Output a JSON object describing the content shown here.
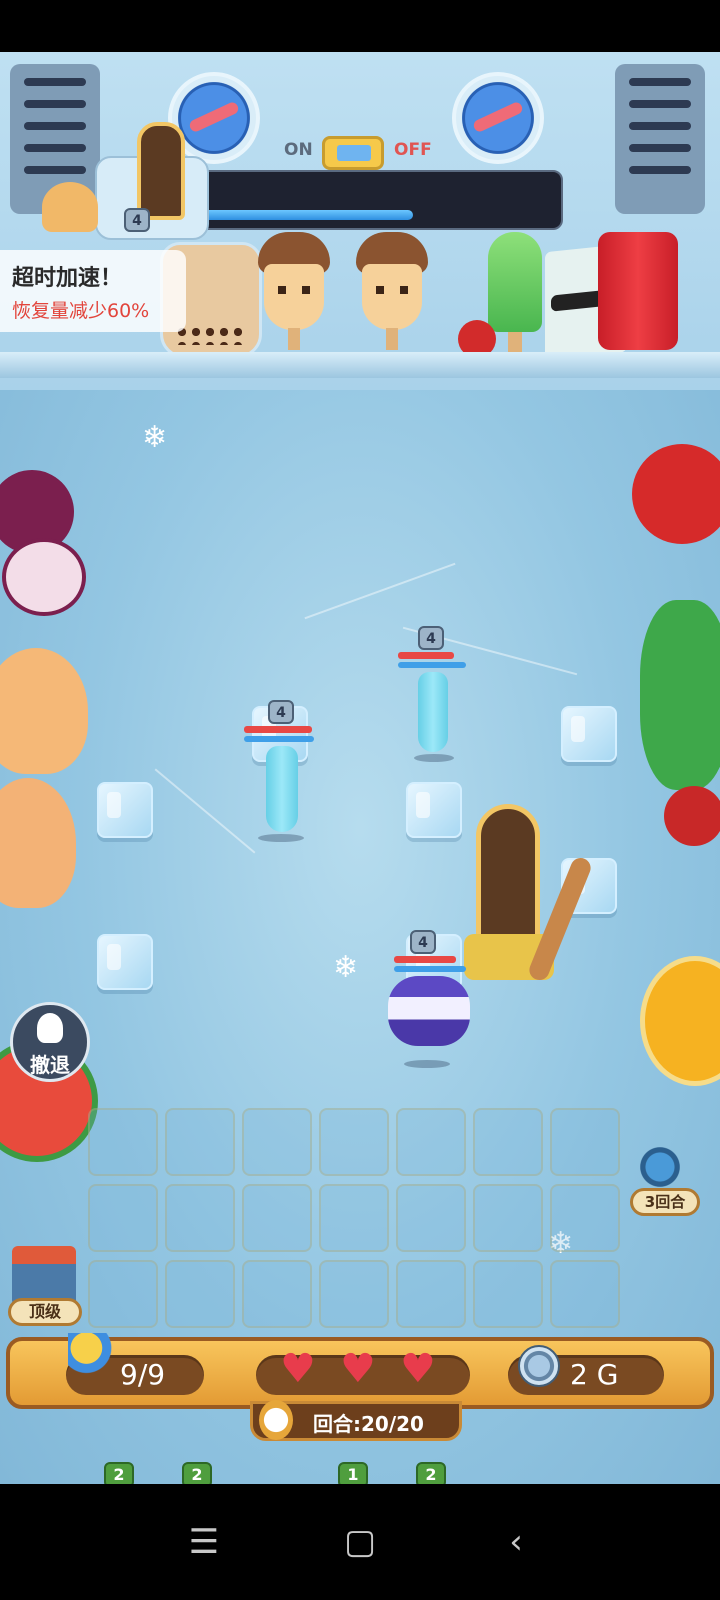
{
  "header": {
    "switch_on": "ON",
    "switch_off": "OFF",
    "boss_level": "4",
    "boss_hp_fraction": 0.61
  },
  "alert": {
    "title": "超时加速！",
    "subtitle": "恢复量减少60%"
  },
  "field_units": [
    {
      "name": "cyan-bottle-top",
      "level": "4"
    },
    {
      "name": "cyan-bottle-left",
      "level": "4"
    },
    {
      "name": "purple-macaron",
      "level": "4"
    }
  ],
  "controls": {
    "retreat_label": "撤退",
    "rounds_left_label": "3回合",
    "shop_label": "顶级"
  },
  "status": {
    "population": "9/9",
    "lives": 3,
    "gold": "2 G",
    "round": "回合:20/20"
  },
  "bench": {
    "levels": [
      "2",
      "2",
      "1",
      "2"
    ]
  },
  "nav": {
    "menu": "☰",
    "home": "▢",
    "back": "‹"
  },
  "colors": {
    "hp": "#e84845",
    "mana": "#3f9fe8",
    "bar_wood": "#e39b34",
    "alert_red": "#e2453c"
  }
}
